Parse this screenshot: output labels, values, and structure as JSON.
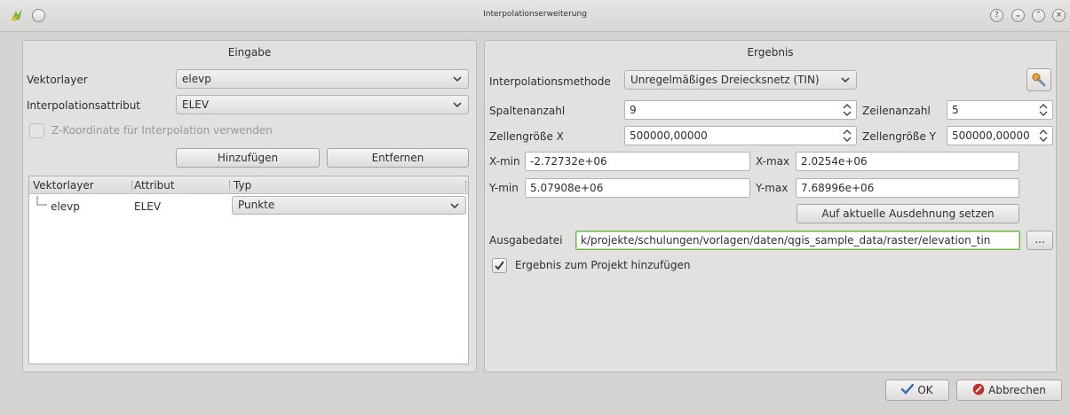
{
  "window": {
    "title": "Interpolationserweiterung",
    "controls": {
      "help": "?",
      "minimize": "⌄",
      "maximize": "⌃",
      "close": "×"
    }
  },
  "input_group": {
    "title": "Eingabe",
    "vector_layer_label": "Vektorlayer",
    "vector_layer_value": "elevp",
    "interp_attr_label": "Interpolationsattribut",
    "interp_attr_value": "ELEV",
    "z_coord_label": "Z-Koordinate für Interpolation verwenden",
    "add_button": "Hinzufügen",
    "remove_button": "Entfernen",
    "table": {
      "headers": [
        "Vektorlayer",
        "Attribut",
        "Typ"
      ],
      "rows": [
        {
          "layer": "elevp",
          "attribute": "ELEV",
          "type": "Punkte"
        }
      ]
    }
  },
  "output_group": {
    "title": "Ergebnis",
    "method_label": "Interpolationsmethode",
    "method_value": "Unregelmäßiges Dreiecksnetz (TIN)",
    "columns_label": "Spaltenanzahl",
    "columns_value": "9",
    "rows_label": "Zeilenanzahl",
    "rows_value": "5",
    "cellsize_x_label": "Zellengröße X",
    "cellsize_x_value": "500000,00000",
    "cellsize_y_label": "Zellengröße Y",
    "cellsize_y_value": "500000,00000",
    "xmin_label": "X-min",
    "xmin_value": "-2.72732e+06",
    "xmax_label": "X-max",
    "xmax_value": "2.0254e+06",
    "ymin_label": "Y-min",
    "ymin_value": "5.07908e+06",
    "ymax_label": "Y-max",
    "ymax_value": "7.68996e+06",
    "set_extent_button": "Auf aktuelle Ausdehnung setzen",
    "output_file_label": "Ausgabedatei",
    "output_file_value": "k/projekte/schulungen/vorlagen/daten/qgis_sample_data/raster/elevation_tin",
    "browse_button": "...",
    "add_to_project_label": "Ergebnis zum Projekt hinzufügen",
    "add_to_project_checked": true
  },
  "footer": {
    "ok_button": "OK",
    "cancel_button": "Abbrechen"
  },
  "colors": {
    "window_bg": "#d6d4d2",
    "panel_bg": "#e3e1df",
    "focus_border": "#6fb24a",
    "ok_check": "#3d6fb6",
    "cancel_red": "#c0302a"
  }
}
